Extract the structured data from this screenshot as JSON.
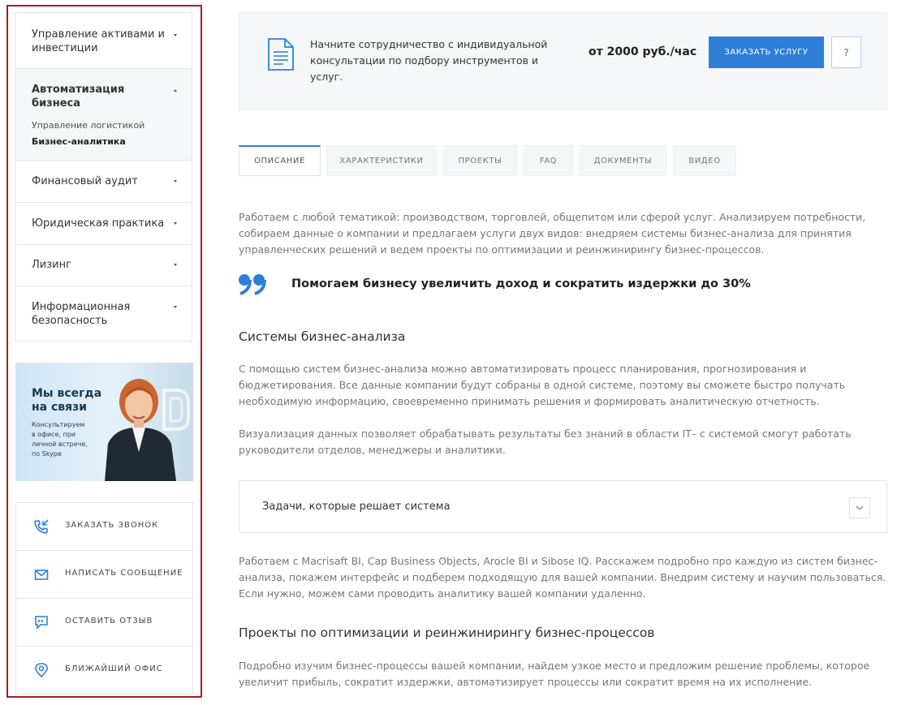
{
  "sidebar": {
    "menu": [
      {
        "label": "Управление активами и инвестиции"
      },
      {
        "label": "Автоматизация бизнеса",
        "sub": [
          "Управление логистикой",
          "Бизнес-аналитика"
        ]
      },
      {
        "label": "Финансовый аудит"
      },
      {
        "label": "Юридическая практика"
      },
      {
        "label": "Лизинг"
      },
      {
        "label": "Информационная безопасность"
      }
    ],
    "banner": {
      "title_line1": "Мы всегда",
      "title_line2": "на связи",
      "sub_line1": "Консультируем",
      "sub_line2": "в офисе, при",
      "sub_line3": "личной встрече,",
      "sub_line4": "по Skype"
    },
    "actions": [
      {
        "label": "ЗАКАЗАТЬ ЗВОНОК",
        "icon": "phone-callback-icon"
      },
      {
        "label": "НАПИСАТЬ СООБЩЕНИЕ",
        "icon": "envelope-icon"
      },
      {
        "label": "ОСТАВИТЬ ОТЗЫВ",
        "icon": "review-bubble-icon"
      },
      {
        "label": "БЛИЖАЙШИЙ ОФИС",
        "icon": "map-pin-icon"
      }
    ]
  },
  "promo": {
    "text": "Начните сотрудничество с индивидуальной консультации по подбору инструментов и услуг.",
    "price": "от 2000 руб./час",
    "order_button": "ЗАКАЗАТЬ УСЛУГУ",
    "help_button": "?"
  },
  "tabs": [
    "ОПИСАНИЕ",
    "ХАРАКТЕРИСТИКИ",
    "ПРОЕКТЫ",
    "FAQ",
    "ДОКУМЕНТЫ",
    "ВИДЕО"
  ],
  "content": {
    "intro": "Работаем с любой тематикой: производством, торговлей, общепитом или сферой услуг. Анализируем потребности, собираем данные о компании и предлагаем услуги двух видов: внедряем системы бизнес-анализа для принятия управленческих решений и ведем проекты по оптимизации и реинжинирингу бизнес-процессов.",
    "quote": "Помогаем бизнесу увеличить доход и сократить издержки до 30%",
    "heading1": "Системы бизнес-анализа",
    "para1": "С помощью систем бизнес-анализа можно автоматизировать процесс планирования, прогнозирования и бюджетирования. Все данные компании будут собраны в одной системе, поэтому вы сможете быстро получать необходимую информацию, своевременно принимать решения и формировать аналитическую отчетность.",
    "para2": "Визуализация данных позволяет обрабатывать результаты без знаний в области IT– с системой смогут работать руководители отделов, менеджеры и аналитики.",
    "accordion_title": "Задачи, которые решает система",
    "para3": "Работаем с Macrisaft BI, Cap Business Objects, Arocle BI и Sibose IQ. Расскажем подробно про каждую из систем бизнес-анализа, покажем интерфейс и подберем подходящую для вашей компании. Внедрим систему и научим пользоваться. Если нужно, можем сами проводить аналитику вашей компании удаленно.",
    "heading2": "Проекты по оптимизации и реинжинирингу бизнес-процессов",
    "para4": "Подробно изучим бизнес-процессы вашей компании, найдем узкое место и предложим решение проблемы, которое увеличит прибыль, сократит издержки, автоматизирует процессы или сократит время на их исполнение."
  },
  "colors": {
    "accent": "#2f7fd8",
    "highlight_border": "#a41e22",
    "promo_bg": "#f4f6f8"
  }
}
